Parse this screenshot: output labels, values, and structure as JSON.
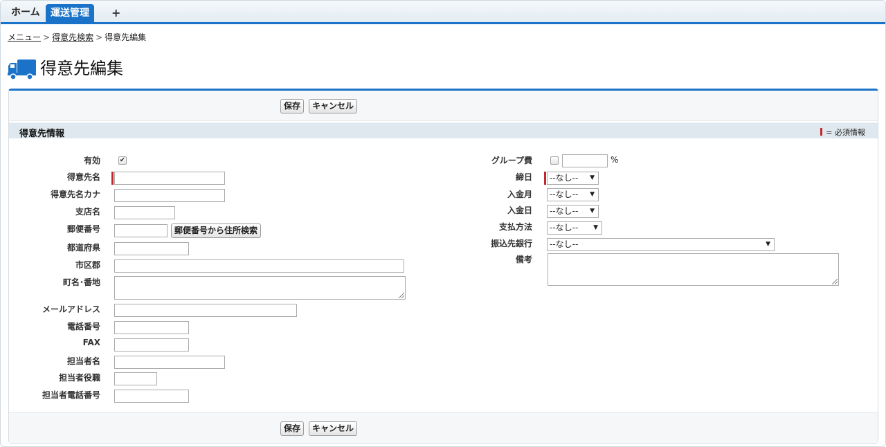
{
  "tabs": {
    "home": "ホーム",
    "active": "運送管理",
    "add": "+"
  },
  "breadcrumb": {
    "menu": "メニュー",
    "search": "得意先検索",
    "current": "得意先編集",
    "separator": ">"
  },
  "page": {
    "title": "得意先編集",
    "icon": "truck-icon"
  },
  "buttons": {
    "save": "保存",
    "cancel": "キャンセル",
    "address_search": "郵便番号から住所検索"
  },
  "section": {
    "title": "得意先情報",
    "required_legend": "= 必須情報"
  },
  "left_fields": {
    "active": "有効",
    "customer_name": "得意先名",
    "customer_kana": "得意先名カナ",
    "branch_name": "支店名",
    "postal_code": "郵便番号",
    "prefecture": "都道府県",
    "city": "市区郡",
    "town": "町名･番地",
    "email": "メールアドレス",
    "phone": "電話番号",
    "fax": "FAX",
    "contact_name": "担当者名",
    "contact_title": "担当者役職",
    "contact_phone": "担当者電話番号"
  },
  "right_fields": {
    "group_fee": "グループ費",
    "percent": "%",
    "closing_day": "締日",
    "payment_month": "入金月",
    "payment_day": "入金日",
    "payment_method": "支払方法",
    "transfer_bank": "振込先銀行",
    "remarks": "備考"
  },
  "values": {
    "active_checked": "✔",
    "closing_day": "--なし--",
    "payment_month": "--なし--",
    "payment_day": "--なし--",
    "payment_method": "--なし--",
    "transfer_bank": "--なし--"
  },
  "colors": {
    "accent": "#1a73c8",
    "required": "#c0282d",
    "section_bg": "#dfe8ee"
  }
}
